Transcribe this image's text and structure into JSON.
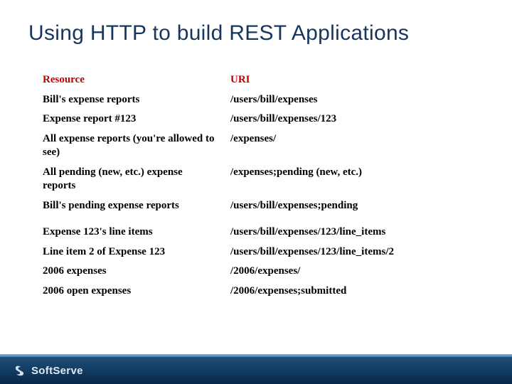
{
  "slide": {
    "title": "Using HTTP to build REST Applications",
    "headers": {
      "resource": "Resource",
      "uri": "URI"
    },
    "rows": [
      {
        "resource": "Bill's expense reports",
        "uri": "/users/bill/expenses",
        "gap": false
      },
      {
        "resource": "Expense report #123",
        "uri": "/users/bill/expenses/123",
        "gap": false
      },
      {
        "resource": "All expense reports (you're allowed to see)",
        "uri": "/expenses/",
        "gap": false
      },
      {
        "resource": "All pending (new, etc.) expense reports",
        "uri": "/expenses;pending (new, etc.)",
        "gap": false
      },
      {
        "resource": "Bill's pending expense reports",
        "uri": "/users/bill/expenses;pending",
        "gap": false
      },
      {
        "resource": "Expense 123's line items",
        "uri": "/users/bill/expenses/123/line_items",
        "gap": true
      },
      {
        "resource": "Line item 2 of Expense 123",
        "uri": "/users/bill/expenses/123/line_items/2",
        "gap": false
      },
      {
        "resource": "2006 expenses",
        "uri": "/2006/expenses/",
        "gap": false
      },
      {
        "resource": "2006 open expenses",
        "uri": "/2006/expenses;submitted",
        "gap": false
      }
    ]
  },
  "footer": {
    "brand": "SoftServe"
  }
}
